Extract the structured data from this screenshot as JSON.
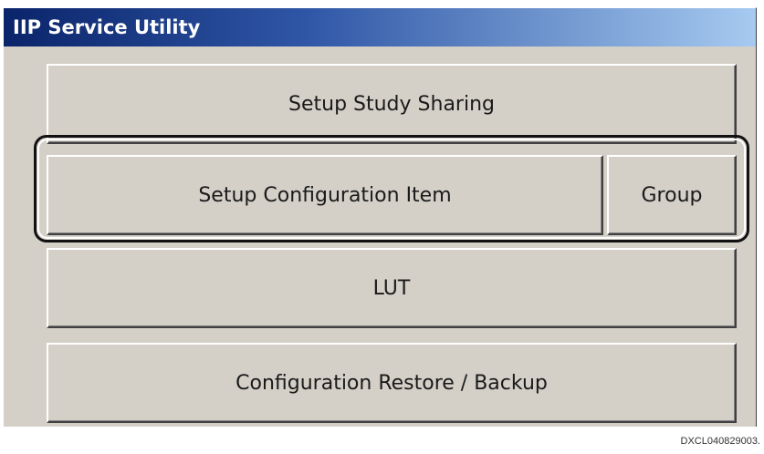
{
  "window": {
    "title": "IIP Service Utility"
  },
  "buttons": {
    "setup_study_sharing": "Setup Study Sharing",
    "setup_configuration_item": "Setup Configuration Item",
    "group": "Group",
    "lut": "LUT",
    "configuration_restore_backup": "Configuration Restore / Backup"
  },
  "caption": "DXCL040829003."
}
